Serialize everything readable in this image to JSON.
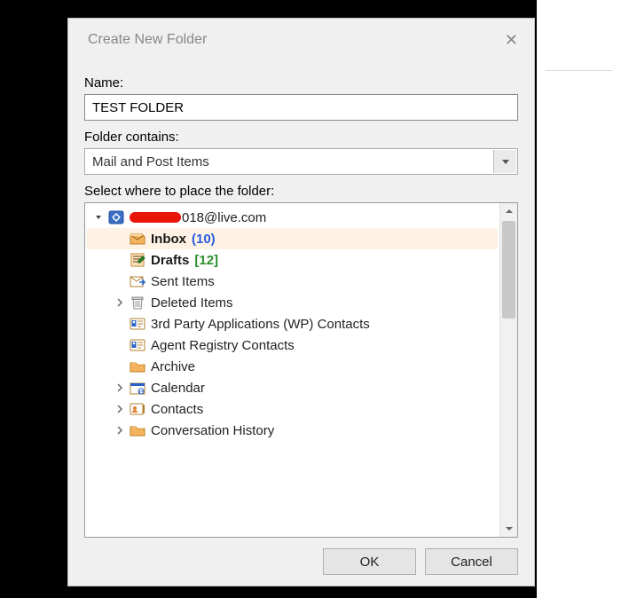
{
  "dialog": {
    "title": "Create New Folder",
    "name_label": "Name:",
    "name_value": "TEST FOLDER",
    "contains_label": "Folder contains:",
    "contains_value": "Mail and Post Items",
    "placement_label": "Select where to place the folder:",
    "buttons": {
      "ok": "OK",
      "cancel": "Cancel"
    }
  },
  "account": {
    "suffix": "018@live.com",
    "redaction_color": "#e9160a"
  },
  "tree": {
    "items": [
      {
        "label": "Inbox",
        "count": "(10)",
        "count_style": "blue",
        "bold": true,
        "icon": "inbox",
        "expand": "",
        "selected": true
      },
      {
        "label": "Drafts",
        "count": "[12]",
        "count_style": "green",
        "bold": true,
        "icon": "drafts",
        "expand": ""
      },
      {
        "label": "Sent Items",
        "icon": "sent",
        "expand": ""
      },
      {
        "label": "Deleted Items",
        "icon": "deleted",
        "expand": "chev"
      },
      {
        "label": "3rd Party Applications (WP) Contacts",
        "icon": "contact-card",
        "expand": ""
      },
      {
        "label": "Agent Registry Contacts",
        "icon": "contact-card",
        "expand": ""
      },
      {
        "label": "Archive",
        "icon": "folder",
        "expand": ""
      },
      {
        "label": "Calendar",
        "icon": "calendar",
        "expand": "chev"
      },
      {
        "label": "Contacts",
        "icon": "contacts",
        "expand": "chev"
      },
      {
        "label": "Conversation History",
        "icon": "folder",
        "expand": "chev"
      }
    ]
  }
}
